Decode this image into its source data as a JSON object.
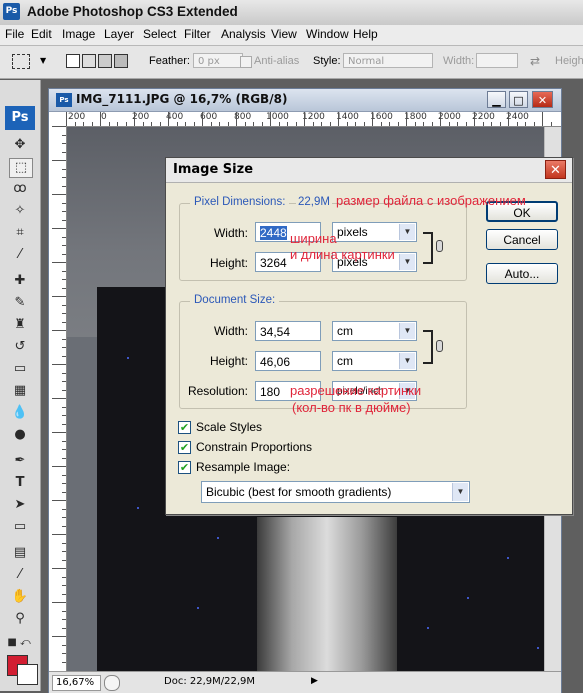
{
  "app": {
    "icon": "Ps",
    "title": "Adobe Photoshop CS3 Extended"
  },
  "menu": [
    "File",
    "Edit",
    "Image",
    "Layer",
    "Select",
    "Filter",
    "Analysis",
    "View",
    "Window",
    "Help"
  ],
  "options": {
    "feather_label": "Feather:",
    "feather_value": "0 px",
    "antialias_label": "Anti-alias",
    "style_label": "Style:",
    "style_value": "Normal",
    "width_label": "Width:",
    "height_label": "Heigh"
  },
  "toolbox": {
    "logo": "Ps"
  },
  "document": {
    "title": "IMG_7111.JPG @ 16,7% (RGB/8)",
    "ruler_ticks": [
      "200",
      "0",
      "200",
      "400",
      "600",
      "800",
      "1000",
      "1200",
      "1400",
      "1600",
      "1800",
      "2000",
      "2200",
      "2400"
    ],
    "zoom": "16,67%",
    "doc_status": "Doc: 22,9M/22,9M"
  },
  "dialog": {
    "title": "Image Size",
    "pixel_dimensions": {
      "label": "Pixel Dimensions:",
      "size": "22,9M",
      "width_label": "Width:",
      "width_value": "2448",
      "width_unit": "pixels",
      "height_label": "Height:",
      "height_value": "3264",
      "height_unit": "pixels"
    },
    "document_size": {
      "label": "Document Size:",
      "width_label": "Width:",
      "width_value": "34,54",
      "width_unit": "cm",
      "height_label": "Height:",
      "height_value": "46,06",
      "height_unit": "cm",
      "resolution_label": "Resolution:",
      "resolution_value": "180",
      "resolution_unit": "pixels/inch"
    },
    "buttons": {
      "ok": "OK",
      "cancel": "Cancel",
      "auto": "Auto..."
    },
    "options": {
      "scale_styles": {
        "label": "Scale Styles",
        "checked": true
      },
      "constrain": {
        "label": "Constrain Proportions",
        "checked": true
      },
      "resample": {
        "label": "Resample Image:",
        "checked": true
      },
      "method": "Bicubic (best for smooth gradients)"
    }
  },
  "annotations": {
    "file_size": "размер файла с изображением",
    "dims_line1": "ширина",
    "dims_line2": "и длина картинки",
    "res_line1": "разрешение картинки",
    "res_line2": "(кол-во пк в дюйме)"
  },
  "colors": {
    "foreground": "#d21e32",
    "background": "#ffffff",
    "annotation": "#e0253a",
    "group_label": "#2b58b8"
  }
}
